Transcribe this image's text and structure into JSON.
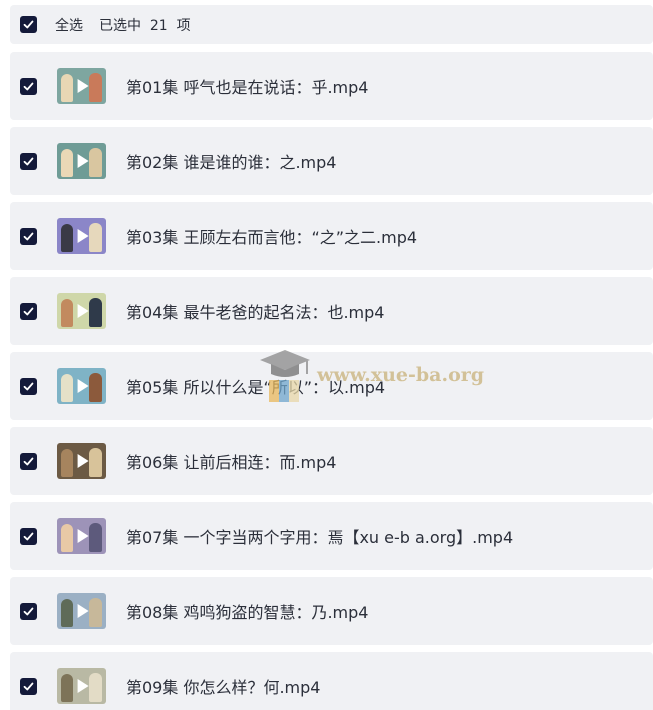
{
  "header": {
    "select_all_label": "全选",
    "selected_text": "已选中  21  项",
    "checked": true
  },
  "files": [
    {
      "title": "第01集 呼气也是在说话：乎.mp4",
      "checked": true,
      "thumb": {
        "bg": "#7ea6a0",
        "c1": "#e8d7b4",
        "c2": "#c97a5a"
      }
    },
    {
      "title": "第02集 谁是谁的谁：之.mp4",
      "checked": true,
      "thumb": {
        "bg": "#6f9c96",
        "c1": "#ead8b6",
        "c2": "#d9c6a0"
      }
    },
    {
      "title": "第03集 王顾左右而言他：“之”之二.mp4",
      "checked": true,
      "thumb": {
        "bg": "#8b86c8",
        "c1": "#3a3a46",
        "c2": "#e6d8bc"
      }
    },
    {
      "title": "第04集 最牛老爸的起名法：也.mp4",
      "checked": true,
      "thumb": {
        "bg": "#cfd7a9",
        "c1": "#c28a5f",
        "c2": "#2f3a4a"
      }
    },
    {
      "title": "第05集 所以什么是“所以”：以.mp4",
      "checked": true,
      "thumb": {
        "bg": "#7fb3c6",
        "c1": "#e5e1c8",
        "c2": "#8c5a3c"
      }
    },
    {
      "title": "第06集 让前后相连：而.mp4",
      "checked": true,
      "thumb": {
        "bg": "#6c5a44",
        "c1": "#a6845e",
        "c2": "#d8c39a"
      }
    },
    {
      "title": "第07集 一个字当两个字用：焉【xu e-b a.org】.mp4",
      "checked": true,
      "thumb": {
        "bg": "#9d93b8",
        "c1": "#e8c9a6",
        "c2": "#5d5a7c"
      }
    },
    {
      "title": "第08集 鸡鸣狗盗的智慧：乃.mp4",
      "checked": true,
      "thumb": {
        "bg": "#9bb0c4",
        "c1": "#5f6b58",
        "c2": "#c7b89a"
      }
    },
    {
      "title": "第09集 你怎么样？何.mp4",
      "checked": true,
      "thumb": {
        "bg": "#b9b9a4",
        "c1": "#7d7358",
        "c2": "#e3dcc6"
      }
    }
  ],
  "watermark": {
    "text": "www.xue-ba.org"
  },
  "colors": {
    "row_bg": "#f0f1f4",
    "checkbox": "#141a3a",
    "text": "#2b2f3a"
  }
}
